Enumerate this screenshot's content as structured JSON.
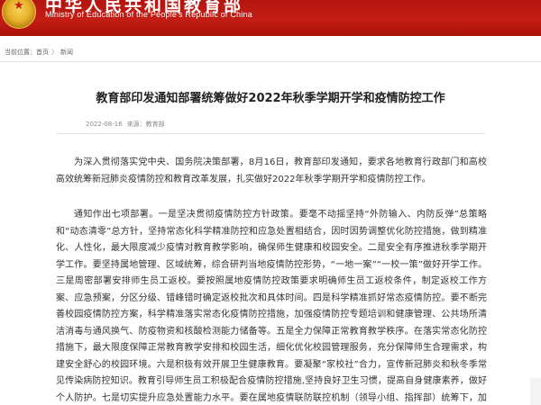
{
  "header": {
    "title": "中华人民共和国教育部",
    "subtitle": "Ministry of Education of the People's Republic of China"
  },
  "breadcrumb": {
    "prefix": "当前位置：",
    "home": "首页",
    "separator": "〉",
    "section": "新闻"
  },
  "article": {
    "title": "教育部印发通知部署统筹做好2022年秋季学期开学和疫情防控工作",
    "date": "2022-08-16",
    "source": "来源：教育部",
    "paragraphs": [
      "为深入贯彻落实党中央、国务院决策部署，8月16日，教育部印发通知，要求各地教育行政部门和高校高效统筹新冠肺炎疫情防控和教育改革发展，扎实做好2022年秋季学期开学和疫情防控工作。",
      "通知作出七项部署。一是坚决贯彻疫情防控方针政策。要毫不动摇坚持“外防输入、内防反弹”总策略和“动态清零”总方针，坚持常态化科学精准防控和应急处置相结合，因时因势调整优化防控措施，做到精准化、人性化，最大限度减少疫情对教育教学影响，确保师生健康和校园安全。二是安全有序推进秋季学期开学工作。要坚持属地管理、区域统筹，综合研判当地疫情防控形势，“一地一案”“一校一策”做好开学工作。三是周密部署安排师生员工返校。要按照属地疫情防控政策要求明确师生员工返校条件，制定返校工作方案、应急预案，分区分级、错峰错时确定返校批次和具体时间。四是科学精准抓好常态疫情防控。要不断完善校园疫情防控方案，科学精准落实常态化疫情防控措施，加强疫情防控专题培训和健康管理、公共场所清洁消毒与通风换气、防疫物资和核酸检测能力储备等。五是全力保障正常教育教学秩序。在落实常态化防控措施下，最大限度保障正常教育教学安排和校园生活，细化优化校园管理服务，充分保障师生合理需求，构建安全舒心的校园环境。六是积极有效开展卫生健康教育。要凝聚“家校社”合力，宣传新冠肺炎和秋冬季常见传染病防控知识。教育引导师生员工积极配合疫情防控措施,坚持良好卫生习惯，提高自身健康素养，做好个人防护。七是切实提升应急处置能力水平。要在属地疫情联防联控机制（领导小组、指挥部）统筹下，加强配合协作与信息共享，完善校园突发疫情应急处置预案，开展疫情防控应急演练。"
    ]
  },
  "colors": {
    "header_red": "#c41d14",
    "emblem_gold": "#e8b22b",
    "title_text": "#222222",
    "body_text": "#333333"
  },
  "icons": {
    "emblem": "national-emblem-icon",
    "star": "star-icon"
  }
}
